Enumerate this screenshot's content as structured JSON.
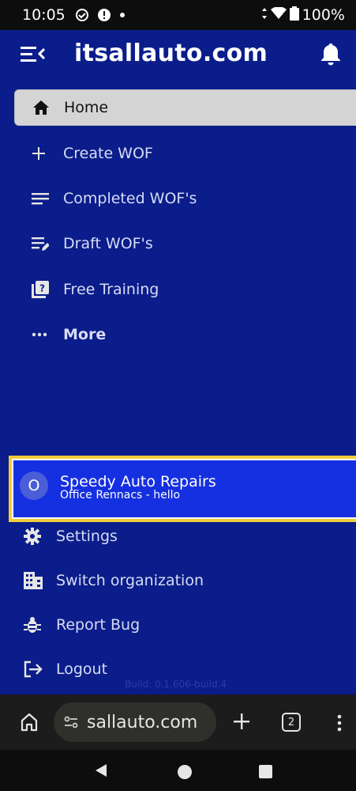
{
  "status_bar": {
    "time": "10:05",
    "battery": "100%",
    "icons": [
      "do-not-disturb-icon",
      "alert-icon",
      "dot-icon",
      "wifi-icon",
      "battery-icon"
    ]
  },
  "app_bar": {
    "title": "itsallauto.com",
    "menu_icon": "menu-collapse-icon",
    "notification_icon": "bell-icon"
  },
  "nav": {
    "items": [
      {
        "label": "Home",
        "icon": "home-icon",
        "active": true
      },
      {
        "label": "Create WOF",
        "icon": "plus-icon"
      },
      {
        "label": "Completed WOF's",
        "icon": "list-icon"
      },
      {
        "label": "Draft WOF's",
        "icon": "edit-list-icon"
      },
      {
        "label": "Free Training",
        "icon": "help-book-icon"
      },
      {
        "label": "More",
        "icon": "more-icon"
      }
    ]
  },
  "organization": {
    "avatar_letter": "O",
    "name": "Speedy Auto Repairs",
    "subtitle": "Office Rennacs - hello",
    "highlight_color": "#f3cc3c"
  },
  "bottom_menu": {
    "items": [
      {
        "label": "Settings",
        "icon": "gear-icon"
      },
      {
        "label": "Switch organization",
        "icon": "building-icon"
      },
      {
        "label": "Report Bug",
        "icon": "bug-icon"
      },
      {
        "label": "Logout",
        "icon": "logout-icon"
      }
    ]
  },
  "build_info": "Build: 0.1.606-build.4",
  "browser": {
    "url": "sallauto.com",
    "tab_count": "2"
  },
  "colors": {
    "drawer_background": "#0a1d8a",
    "active_item": "#d4d4d4",
    "org_card": "#1530e0"
  }
}
